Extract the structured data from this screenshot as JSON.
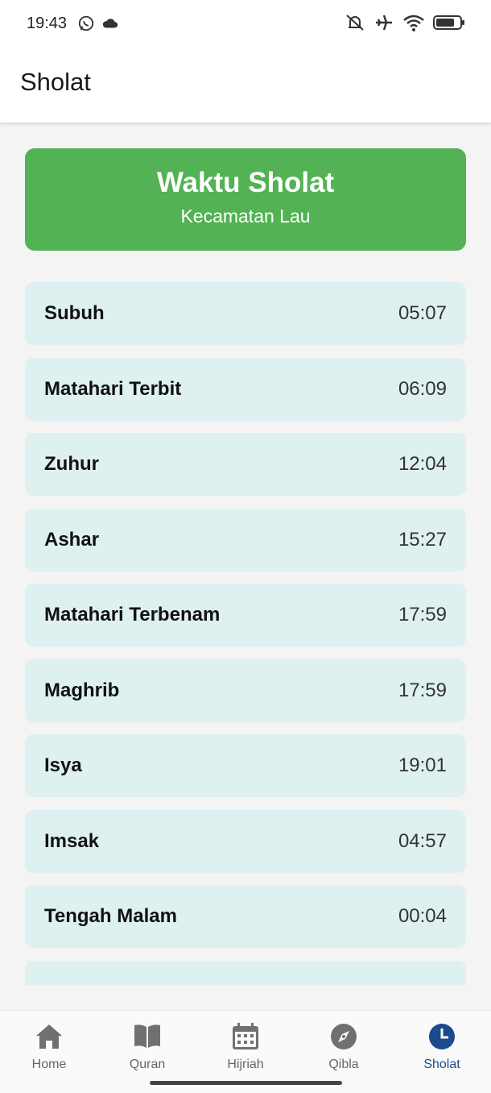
{
  "status_bar": {
    "time": "19:43",
    "left_icons": [
      "whatsapp-icon",
      "cloud-icon"
    ],
    "right_icons": [
      "mute-icon",
      "airplane-icon",
      "wifi-icon",
      "battery-icon"
    ]
  },
  "app_bar": {
    "title": "Sholat"
  },
  "header_card": {
    "title": "Waktu Sholat",
    "subtitle": "Kecamatan Lau",
    "color": "#52b254"
  },
  "prayers": [
    {
      "name": "Subuh",
      "time": "05:07"
    },
    {
      "name": "Matahari Terbit",
      "time": "06:09"
    },
    {
      "name": "Zuhur",
      "time": "12:04"
    },
    {
      "name": "Ashar",
      "time": "15:27"
    },
    {
      "name": "Matahari Terbenam",
      "time": "17:59"
    },
    {
      "name": "Maghrib",
      "time": "17:59"
    },
    {
      "name": "Isya",
      "time": "19:01"
    },
    {
      "name": "Imsak",
      "time": "04:57"
    },
    {
      "name": "Tengah Malam",
      "time": "00:04"
    }
  ],
  "bottom_nav": {
    "items": [
      {
        "label": "Home",
        "icon": "home-icon"
      },
      {
        "label": "Quran",
        "icon": "book-icon"
      },
      {
        "label": "Hijriah",
        "icon": "calendar-icon"
      },
      {
        "label": "Qibla",
        "icon": "compass-icon"
      },
      {
        "label": "Sholat",
        "icon": "clock-icon",
        "active": true
      }
    ],
    "active_color": "#1d4a8c"
  }
}
